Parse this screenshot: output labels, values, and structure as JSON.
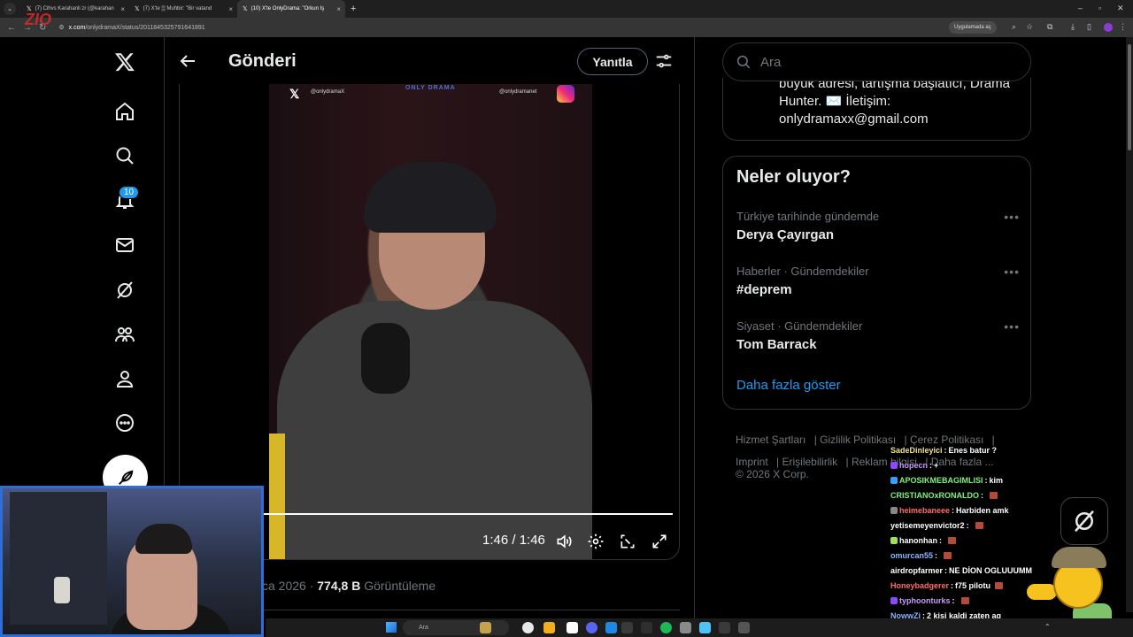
{
  "browser": {
    "tabs": [
      {
        "label": "(7) Cihvs Karahanli zr (@karahan"
      },
      {
        "label": "(7) X'te ▒ Muhbir: \"Bir vatand"
      },
      {
        "label": "(10) X'te OnlyDrama: \"Orkun Iş"
      }
    ],
    "url_host": "x.com",
    "url_path": "/onlydramaX/status/2011845325791641891",
    "open_in_app": "Uygulamada aç",
    "watermark": "ZIO"
  },
  "nav": {
    "notifications_badge": "10"
  },
  "post": {
    "title": "Gönderi",
    "reply_label": "Yanıtla",
    "video": {
      "overlay_handle_left": "@onlydramaX",
      "overlay_logo": "ONLY DRAMA",
      "overlay_handle_right": "@onlydramanet",
      "time": "1:46 / 1:46",
      "progress": 1.0
    },
    "meta_date": "ca 2026 · ",
    "meta_views_count": "774,8 B",
    "meta_views_label": " Görüntüleme"
  },
  "search": {
    "placeholder": "Ara"
  },
  "bio": {
    "text": "büyük adresi, tartışma başlatıcı, Drama Hunter. ✉️ İletişim: onlydramaxx@gmail.com"
  },
  "trends": {
    "title": "Neler oluyor?",
    "items": [
      {
        "context": "Türkiye tarihinde gündemde",
        "name": "Derya Çayırgan"
      },
      {
        "context": "Haberler · Gündemdekiler",
        "name": "#deprem"
      },
      {
        "context": "Siyaset · Gündemdekiler",
        "name": "Tom Barrack"
      }
    ],
    "more_label": "Daha fazla göster"
  },
  "footer": {
    "links": [
      "Hizmet Şartları",
      "Gizlilik Politikası",
      "Çerez Politikası",
      "Imprint",
      "Erişilebilirlik",
      "Reklam bilgisi",
      "Daha fazla ..."
    ],
    "copyright": "© 2026 X Corp."
  },
  "chat": [
    {
      "user": "SadeDinleyici",
      "msg": "Enes batur ?",
      "color": "#f0e08a",
      "badge": ""
    },
    {
      "user": "hopecn",
      "msg": "+",
      "color": "#c79bff",
      "badge": "#9147ff"
    },
    {
      "user": "APOSIKMEBAGIMLISI",
      "msg": "kim",
      "color": "#7cf27c",
      "badge": "#33a1ff"
    },
    {
      "user": "CRISTIANOxRONALDO",
      "msg": "",
      "color": "#7cf27c",
      "badge": "",
      "emote": true
    },
    {
      "user": "heimebaneee",
      "msg": "Harbiden amk",
      "color": "#ff6b6b",
      "badge": "#888888"
    },
    {
      "user": "yetisemeyenvictor2",
      "msg": "",
      "color": "#ffffff",
      "badge": "",
      "emote": true
    },
    {
      "user": "hanonhan",
      "msg": "",
      "color": "#ffffff",
      "badge": "#9be15d",
      "emote": true
    },
    {
      "user": "omurcan55",
      "msg": "",
      "color": "#8ab4ff",
      "badge": "",
      "emote": true
    },
    {
      "user": "airdropfarmer",
      "msg": "NE DİON OGLUUUMM",
      "color": "#ffffff",
      "badge": ""
    },
    {
      "user": "Honeybadgerer",
      "msg": "f75 pilotu",
      "color": "#ff6b6b",
      "badge": "",
      "emote": true
    },
    {
      "user": "typhoonturks",
      "msg": "",
      "color": "#c79bff",
      "badge": "#9147ff",
      "emote": true
    },
    {
      "user": "NowwZi",
      "msg": "2 kisi kaldi zaten aq",
      "color": "#8ab4ff",
      "badge": ""
    }
  ],
  "taskbar": {
    "search_placeholder": "Ara"
  },
  "colors": {
    "accent": "#1d9bf0",
    "webcam_border": "#2d6fd6"
  }
}
